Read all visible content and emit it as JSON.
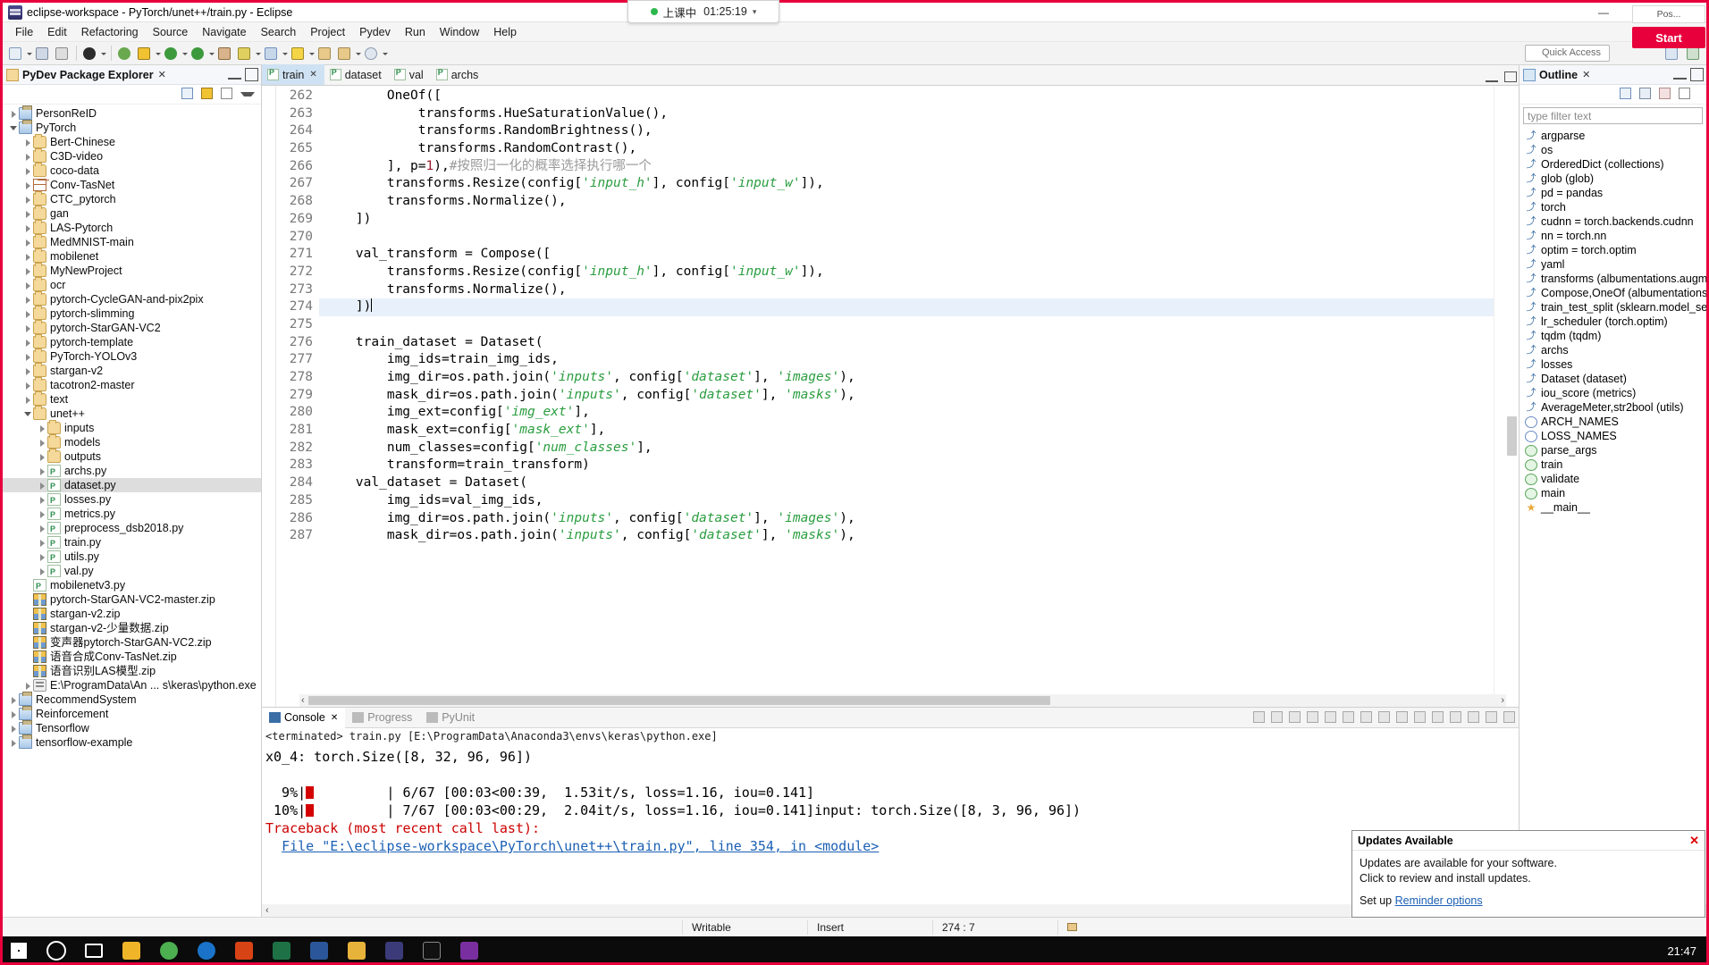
{
  "window": {
    "title": "eclipse-workspace - PyTorch/unet++/train.py - Eclipse",
    "minimize": "—",
    "maximize": "❐",
    "close": "✕"
  },
  "menubar": [
    "File",
    "Edit",
    "Refactoring",
    "Source",
    "Navigate",
    "Search",
    "Project",
    "Pydev",
    "Run",
    "Window",
    "Help"
  ],
  "toolbar": {
    "quick_access_placeholder": "Quick Access"
  },
  "timer": {
    "label": "上课中",
    "time": "01:25:19",
    "chevron": "▾"
  },
  "recorder": {
    "top_label": "Pos...",
    "start_label": "Start"
  },
  "explorer": {
    "title": "PyDev Package Explorer",
    "close_mark": "✕",
    "tree": [
      {
        "indent": 0,
        "arrow": "closed",
        "icon": "proj",
        "label": "PersonReID"
      },
      {
        "indent": 0,
        "arrow": "open",
        "icon": "proj",
        "label": "PyTorch"
      },
      {
        "indent": 1,
        "arrow": "closed",
        "icon": "folder",
        "label": "Bert-Chinese"
      },
      {
        "indent": 1,
        "arrow": "closed",
        "icon": "folder",
        "label": "C3D-video"
      },
      {
        "indent": 1,
        "arrow": "closed",
        "icon": "folder",
        "label": "coco-data"
      },
      {
        "indent": 1,
        "arrow": "closed",
        "icon": "grid",
        "label": "Conv-TasNet"
      },
      {
        "indent": 1,
        "arrow": "closed",
        "icon": "folder",
        "label": "CTC_pytorch"
      },
      {
        "indent": 1,
        "arrow": "closed",
        "icon": "folder",
        "label": "gan"
      },
      {
        "indent": 1,
        "arrow": "closed",
        "icon": "folder",
        "label": "LAS-Pytorch"
      },
      {
        "indent": 1,
        "arrow": "closed",
        "icon": "folder",
        "label": "MedMNIST-main"
      },
      {
        "indent": 1,
        "arrow": "closed",
        "icon": "folder",
        "label": "mobilenet"
      },
      {
        "indent": 1,
        "arrow": "closed",
        "icon": "folder",
        "label": "MyNewProject"
      },
      {
        "indent": 1,
        "arrow": "closed",
        "icon": "folder",
        "label": "ocr"
      },
      {
        "indent": 1,
        "arrow": "closed",
        "icon": "folder",
        "label": "pytorch-CycleGAN-and-pix2pix"
      },
      {
        "indent": 1,
        "arrow": "closed",
        "icon": "folder",
        "label": "pytorch-slimming"
      },
      {
        "indent": 1,
        "arrow": "closed",
        "icon": "folder",
        "label": "pytorch-StarGAN-VC2"
      },
      {
        "indent": 1,
        "arrow": "closed",
        "icon": "folder",
        "label": "pytorch-template"
      },
      {
        "indent": 1,
        "arrow": "closed",
        "icon": "folder",
        "label": "PyTorch-YOLOv3"
      },
      {
        "indent": 1,
        "arrow": "closed",
        "icon": "folder",
        "label": "stargan-v2"
      },
      {
        "indent": 1,
        "arrow": "closed",
        "icon": "folder",
        "label": "tacotron2-master"
      },
      {
        "indent": 1,
        "arrow": "closed",
        "icon": "folder",
        "label": "text"
      },
      {
        "indent": 1,
        "arrow": "open",
        "icon": "folder",
        "label": "unet++"
      },
      {
        "indent": 2,
        "arrow": "closed",
        "icon": "folder",
        "label": "inputs"
      },
      {
        "indent": 2,
        "arrow": "closed",
        "icon": "folder",
        "label": "models"
      },
      {
        "indent": 2,
        "arrow": "closed",
        "icon": "folder",
        "label": "outputs"
      },
      {
        "indent": 2,
        "arrow": "closed",
        "icon": "py",
        "label": "archs.py"
      },
      {
        "indent": 2,
        "arrow": "closed",
        "icon": "py",
        "label": "dataset.py",
        "selected": true
      },
      {
        "indent": 2,
        "arrow": "closed",
        "icon": "py",
        "label": "losses.py"
      },
      {
        "indent": 2,
        "arrow": "closed",
        "icon": "py",
        "label": "metrics.py"
      },
      {
        "indent": 2,
        "arrow": "closed",
        "icon": "py",
        "label": "preprocess_dsb2018.py"
      },
      {
        "indent": 2,
        "arrow": "closed",
        "icon": "py",
        "label": "train.py"
      },
      {
        "indent": 2,
        "arrow": "closed",
        "icon": "py",
        "label": "utils.py"
      },
      {
        "indent": 2,
        "arrow": "closed",
        "icon": "py",
        "label": "val.py"
      },
      {
        "indent": 1,
        "arrow": "none",
        "icon": "py",
        "label": "mobilenetv3.py"
      },
      {
        "indent": 1,
        "arrow": "none",
        "icon": "zip",
        "label": "pytorch-StarGAN-VC2-master.zip"
      },
      {
        "indent": 1,
        "arrow": "none",
        "icon": "zip",
        "label": "stargan-v2.zip"
      },
      {
        "indent": 1,
        "arrow": "none",
        "icon": "zip",
        "label": "stargan-v2-少量数据.zip"
      },
      {
        "indent": 1,
        "arrow": "none",
        "icon": "zip",
        "label": "变声器pytorch-StarGAN-VC2.zip"
      },
      {
        "indent": 1,
        "arrow": "none",
        "icon": "zip",
        "label": "语音合成Conv-TasNet.zip"
      },
      {
        "indent": 1,
        "arrow": "none",
        "icon": "zip",
        "label": "语音识别LAS模型.zip"
      },
      {
        "indent": 1,
        "arrow": "closed",
        "icon": "lib",
        "label": "E:\\ProgramData\\An ... s\\keras\\python.exe"
      },
      {
        "indent": 0,
        "arrow": "closed",
        "icon": "proj",
        "label": "RecommendSystem"
      },
      {
        "indent": 0,
        "arrow": "closed",
        "icon": "proj",
        "label": "Reinforcement"
      },
      {
        "indent": 0,
        "arrow": "closed",
        "icon": "proj",
        "label": "Tensorflow"
      },
      {
        "indent": 0,
        "arrow": "closed",
        "icon": "proj",
        "label": "tensorflow-example"
      }
    ]
  },
  "editor": {
    "tabs": [
      {
        "label": "train",
        "active": true,
        "dirty": "✕"
      },
      {
        "label": "dataset",
        "active": false
      },
      {
        "label": "val",
        "active": false
      },
      {
        "label": "archs",
        "active": false
      }
    ],
    "first_line": 262,
    "highlight_line": 274,
    "lines": [
      {
        "no": 262,
        "text": "        OneOf(["
      },
      {
        "no": 263,
        "text": "            transforms.HueSaturationValue(),"
      },
      {
        "no": 264,
        "text": "            transforms.RandomBrightness(),"
      },
      {
        "no": 265,
        "text": "            transforms.RandomContrast(),"
      },
      {
        "no": 266,
        "text": "        ], p=1),#按照归一化的概率选择执行哪一个"
      },
      {
        "no": 267,
        "text": "        transforms.Resize(config['input_h'], config['input_w']),"
      },
      {
        "no": 268,
        "text": "        transforms.Normalize(),"
      },
      {
        "no": 269,
        "text": "    ])"
      },
      {
        "no": 270,
        "text": ""
      },
      {
        "no": 271,
        "text": "    val_transform = Compose(["
      },
      {
        "no": 272,
        "text": "        transforms.Resize(config['input_h'], config['input_w']),"
      },
      {
        "no": 273,
        "text": "        transforms.Normalize(),"
      },
      {
        "no": 274,
        "text": "    ])"
      },
      {
        "no": 275,
        "text": ""
      },
      {
        "no": 276,
        "text": "    train_dataset = Dataset("
      },
      {
        "no": 277,
        "text": "        img_ids=train_img_ids,"
      },
      {
        "no": 278,
        "text": "        img_dir=os.path.join('inputs', config['dataset'], 'images'),"
      },
      {
        "no": 279,
        "text": "        mask_dir=os.path.join('inputs', config['dataset'], 'masks'),"
      },
      {
        "no": 280,
        "text": "        img_ext=config['img_ext'],"
      },
      {
        "no": 281,
        "text": "        mask_ext=config['mask_ext'],"
      },
      {
        "no": 282,
        "text": "        num_classes=config['num_classes'],"
      },
      {
        "no": 283,
        "text": "        transform=train_transform)"
      },
      {
        "no": 284,
        "text": "    val_dataset = Dataset("
      },
      {
        "no": 285,
        "text": "        img_ids=val_img_ids,"
      },
      {
        "no": 286,
        "text": "        img_dir=os.path.join('inputs', config['dataset'], 'images'),"
      },
      {
        "no": 287,
        "text": "        mask_dir=os.path.join('inputs', config['dataset'], 'masks'),"
      }
    ]
  },
  "console": {
    "tabs": [
      {
        "label": "Console",
        "active": true,
        "close": "✕"
      },
      {
        "label": "Progress",
        "active": false
      },
      {
        "label": "PyUnit",
        "active": false
      }
    ],
    "subtitle": "<terminated> train.py [E:\\ProgramData\\Anaconda3\\envs\\keras\\python.exe]",
    "lines": [
      {
        "text": "x0_4: torch.Size([8, 32, 96, 96])",
        "kind": "plain"
      },
      {
        "text": "",
        "kind": "plain"
      },
      {
        "text": "  9%|█         | 6/67 [00:03<00:39,  1.53it/s, loss=1.16, iou=0.141]",
        "kind": "plain"
      },
      {
        "text": " 10%|█         | 7/67 [00:03<00:29,  2.04it/s, loss=1.16, iou=0.141]input: torch.Size([8, 3, 96, 96])",
        "kind": "plain"
      },
      {
        "text": "Traceback (most recent call last):",
        "kind": "error"
      },
      {
        "text": "  File \"E:\\eclipse-workspace\\PyTorch\\unet++\\train.py\", line 354, in <module>",
        "kind": "link"
      }
    ]
  },
  "outline": {
    "title": "Outline",
    "close_mark": "✕",
    "filter_placeholder": "type filter text",
    "items": [
      {
        "icon": "imp",
        "label": "argparse"
      },
      {
        "icon": "imp",
        "label": "os"
      },
      {
        "icon": "imp",
        "label": "OrderedDict (collections)"
      },
      {
        "icon": "imp",
        "label": "glob (glob)"
      },
      {
        "icon": "imp",
        "label": "pd = pandas"
      },
      {
        "icon": "imp",
        "label": "torch"
      },
      {
        "icon": "imp",
        "label": "cudnn = torch.backends.cudnn"
      },
      {
        "icon": "imp",
        "label": "nn = torch.nn"
      },
      {
        "icon": "imp",
        "label": "optim = torch.optim"
      },
      {
        "icon": "imp",
        "label": "yaml"
      },
      {
        "icon": "imp",
        "label": "transforms (albumentations.augme"
      },
      {
        "icon": "imp",
        "label": "Compose,OneOf (albumentations.c"
      },
      {
        "icon": "imp",
        "label": "train_test_split (sklearn.model_selec"
      },
      {
        "icon": "imp",
        "label": "lr_scheduler (torch.optim)"
      },
      {
        "icon": "imp",
        "label": "tqdm (tqdm)"
      },
      {
        "icon": "imp",
        "label": "archs"
      },
      {
        "icon": "imp",
        "label": "losses"
      },
      {
        "icon": "imp",
        "label": "Dataset (dataset)"
      },
      {
        "icon": "imp",
        "label": "iou_score (metrics)"
      },
      {
        "icon": "imp",
        "label": "AverageMeter,str2bool (utils)"
      },
      {
        "icon": "const",
        "label": "ARCH_NAMES"
      },
      {
        "icon": "const",
        "label": "LOSS_NAMES"
      },
      {
        "icon": "fn",
        "label": "parse_args"
      },
      {
        "icon": "fn",
        "label": "train"
      },
      {
        "icon": "fn",
        "label": "validate"
      },
      {
        "icon": "fn",
        "label": "main"
      },
      {
        "icon": "star",
        "label": "__main__"
      }
    ]
  },
  "statusbar": {
    "writable": "Writable",
    "insert": "Insert",
    "position": "274 : 7"
  },
  "updates": {
    "title": "Updates Available",
    "close": "✕",
    "line1": "Updates are available for your software.",
    "line2": "Click to review and install updates.",
    "line3_prefix": "Set up ",
    "link": "Reminder options"
  },
  "taskbar": {
    "clock": "21:47"
  },
  "colors": {
    "accent_red": "#e8003c",
    "tab_active": "#cfe2f3",
    "string_green": "#2a9d3f",
    "number_red": "#9b1b30",
    "error_red": "#cc0000",
    "link_blue": "#1a5fb4",
    "timer_dot_green": "#2db84d"
  }
}
